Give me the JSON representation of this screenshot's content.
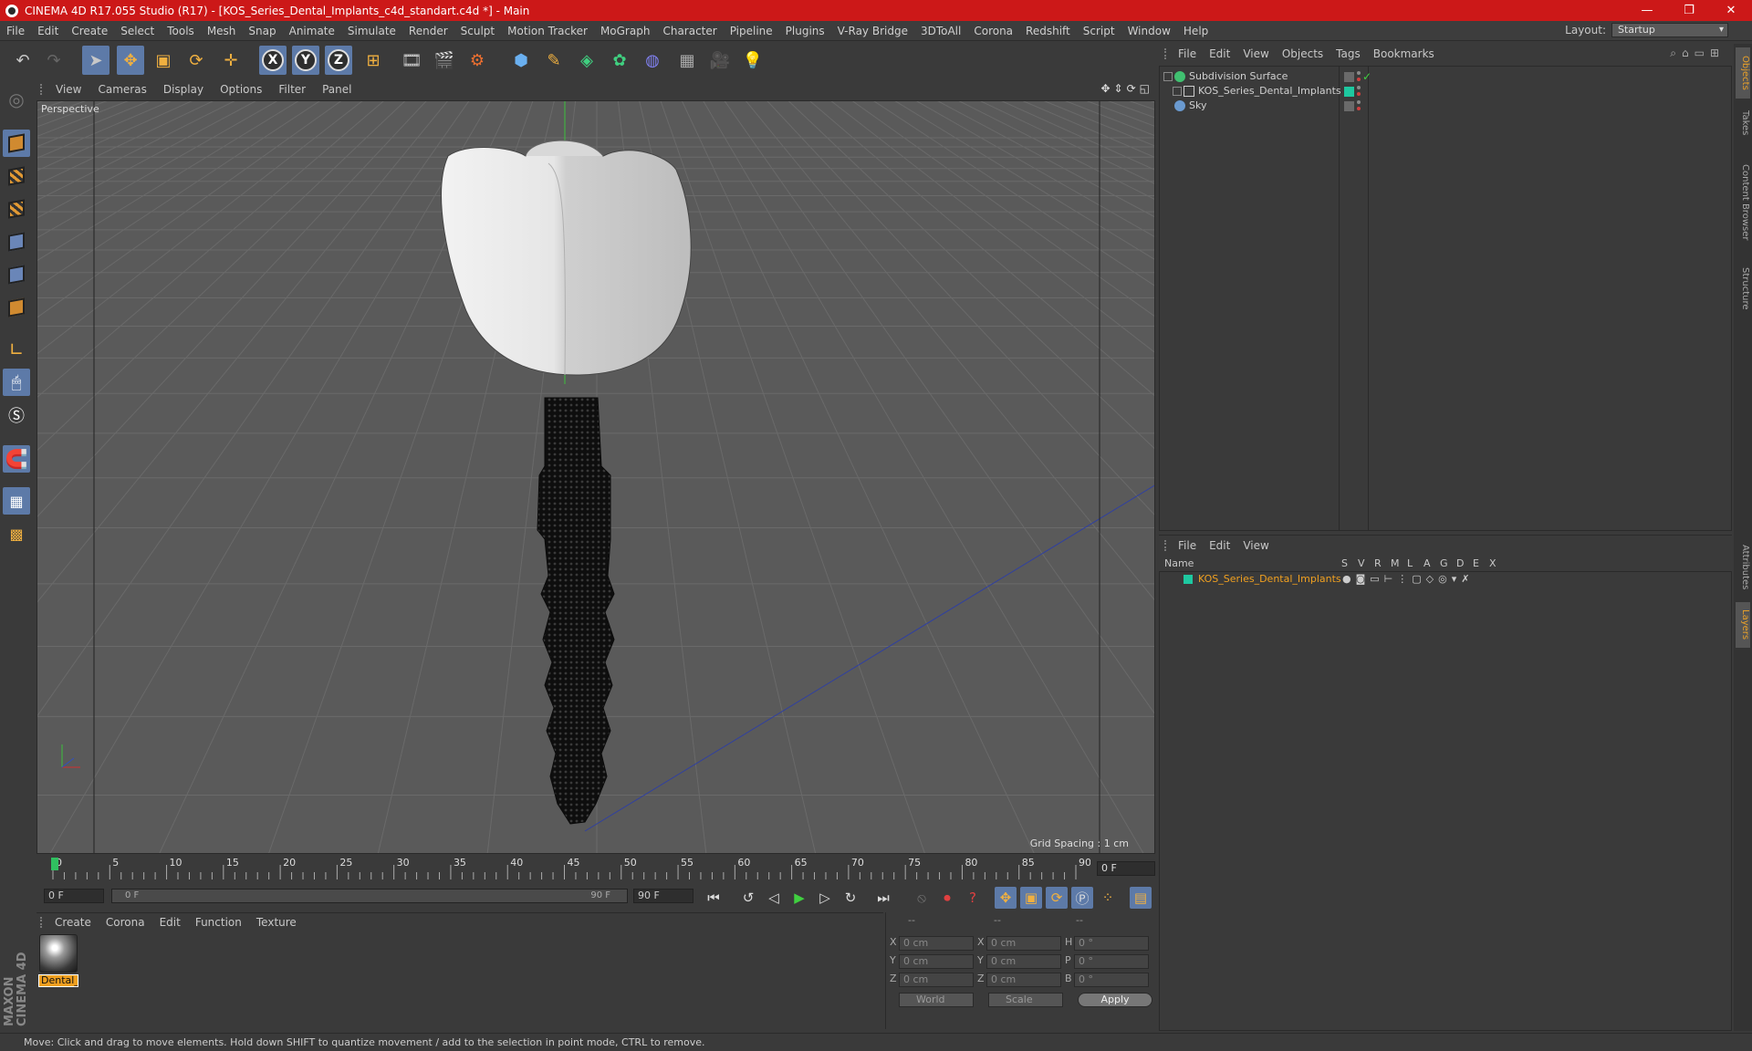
{
  "window": {
    "title": "CINEMA 4D R17.055 Studio (R17) - [KOS_Series_Dental_Implants_c4d_standart.c4d *] - Main",
    "controls": [
      "—",
      "❐",
      "✕"
    ]
  },
  "menubar": {
    "items": [
      "File",
      "Edit",
      "Create",
      "Select",
      "Tools",
      "Mesh",
      "Snap",
      "Animate",
      "Simulate",
      "Render",
      "Sculpt",
      "Motion Tracker",
      "MoGraph",
      "Character",
      "Pipeline",
      "Plugins",
      "V-Ray Bridge",
      "3DToAll",
      "Corona",
      "Redshift",
      "Script",
      "Window",
      "Help"
    ],
    "layout_label": "Layout:",
    "layout_value": "Startup"
  },
  "toolbar": {
    "axis_x": "X",
    "axis_y": "Y",
    "axis_z": "Z"
  },
  "viewport": {
    "menu": [
      "View",
      "Cameras",
      "Display",
      "Options",
      "Filter",
      "Panel"
    ],
    "label": "Perspective",
    "grid_spacing": "Grid Spacing : 1 cm",
    "nav_icons": [
      "✥",
      "⇕",
      "⟳",
      "◱"
    ]
  },
  "timeline": {
    "ticks": [
      "0",
      "5",
      "10",
      "15",
      "20",
      "25",
      "30",
      "35",
      "40",
      "45",
      "50",
      "55",
      "60",
      "65",
      "70",
      "75",
      "80",
      "85",
      "90"
    ],
    "current_frame": "0 F",
    "start_field": "0 F",
    "range_start": "0 F",
    "range_end": "90 F",
    "end_field": "90 F"
  },
  "material_manager": {
    "menu": [
      "Create",
      "Corona",
      "Edit",
      "Function",
      "Texture"
    ],
    "materials": [
      {
        "name": "Dental_I"
      }
    ]
  },
  "coordinates": {
    "headers": [
      "--",
      "--",
      "--"
    ],
    "rows": [
      {
        "l1": "X",
        "v1": "0 cm",
        "l2": "X",
        "v2": "0 cm",
        "l3": "H",
        "v3": "0 °"
      },
      {
        "l1": "Y",
        "v1": "0 cm",
        "l2": "Y",
        "v2": "0 cm",
        "l3": "P",
        "v3": "0 °"
      },
      {
        "l1": "Z",
        "v1": "0 cm",
        "l2": "Z",
        "v2": "0 cm",
        "l3": "B",
        "v3": "0 °"
      }
    ],
    "mode": "World",
    "scale": "Scale",
    "apply_label": "Apply"
  },
  "object_manager": {
    "menu": [
      "File",
      "Edit",
      "View",
      "Objects",
      "Tags",
      "Bookmarks"
    ],
    "objects": [
      {
        "name": "Subdivision Surface"
      },
      {
        "name": "KOS_Series_Dental_Implants"
      },
      {
        "name": "Sky"
      }
    ]
  },
  "layer_manager": {
    "menu": [
      "File",
      "Edit",
      "View"
    ],
    "columns": [
      "Name",
      "S",
      "V",
      "R",
      "M",
      "L",
      "A",
      "G",
      "D",
      "E",
      "X"
    ],
    "layers": [
      {
        "name": "KOS_Series_Dental_Implants",
        "color": "#1ec8a0"
      }
    ]
  },
  "side_tabs": [
    "Objects",
    "Takes",
    "Content Browser",
    "Structure",
    "Attributes",
    "Layers"
  ],
  "maxon_logo": "MAXON CINEMA 4D",
  "status": "Move: Click and drag to move elements. Hold down SHIFT to quantize movement / add to the selection in point mode, CTRL to remove.",
  "colors": {
    "title_bar": "#cc1818",
    "accent": "#5d7aa8",
    "layer_text": "#f0a020"
  }
}
